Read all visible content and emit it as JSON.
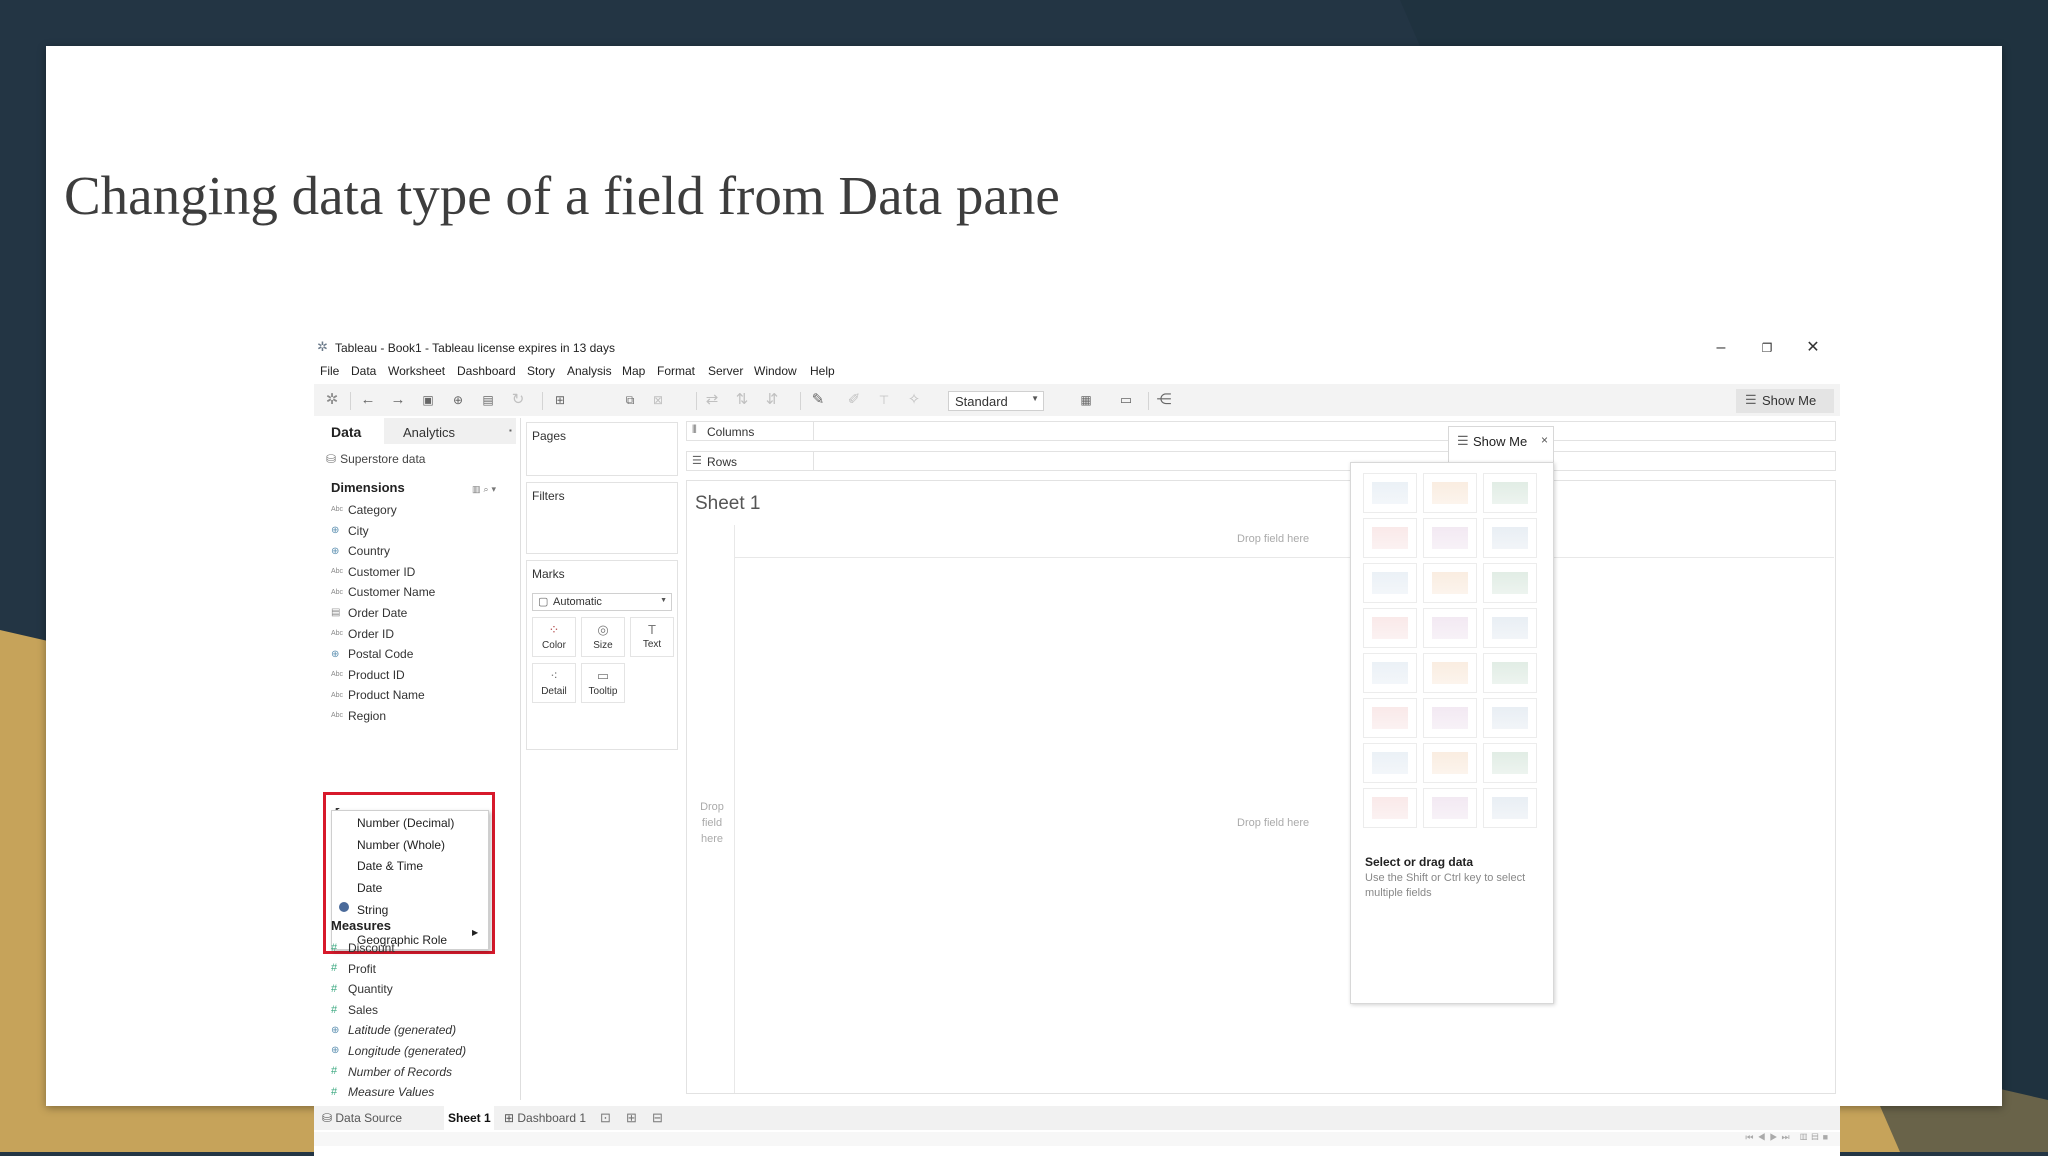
{
  "slide": {
    "title": "Changing data type of a field from Data pane"
  },
  "window": {
    "title": "Tableau - Book1 - Tableau license expires in 13 days",
    "controls": {
      "minimize": "–",
      "restore": "❐",
      "close": "✕"
    }
  },
  "menu": [
    "File",
    "Data",
    "Worksheet",
    "Dashboard",
    "Story",
    "Analysis",
    "Map",
    "Format",
    "Server",
    "Window",
    "Help"
  ],
  "toolbar": {
    "fit_select": "Standard",
    "show_me": "Show Me"
  },
  "data_pane": {
    "tab_data": "Data",
    "tab_analytics": "Analytics",
    "datasource": "Superstore data",
    "dimensions_header": "Dimensions",
    "dimensions": [
      {
        "label": "Category",
        "type": "Abc"
      },
      {
        "label": "City",
        "type": "geo"
      },
      {
        "label": "Country",
        "type": "geo"
      },
      {
        "label": "Customer ID",
        "type": "Abc"
      },
      {
        "label": "Customer Name",
        "type": "Abc"
      },
      {
        "label": "Order Date",
        "type": "date"
      },
      {
        "label": "Order ID",
        "type": "Abc"
      },
      {
        "label": "Postal Code",
        "type": "geo"
      },
      {
        "label": "Product ID",
        "type": "Abc"
      },
      {
        "label": "Product Name",
        "type": "Abc"
      },
      {
        "label": "Region",
        "type": "Abc"
      }
    ],
    "measures_header": "Measures",
    "measures": [
      {
        "label": "Discount",
        "type": "num",
        "italic": false
      },
      {
        "label": "Profit",
        "type": "num",
        "italic": false
      },
      {
        "label": "Quantity",
        "type": "num",
        "italic": false
      },
      {
        "label": "Sales",
        "type": "num",
        "italic": false
      },
      {
        "label": "Latitude (generated)",
        "type": "geo",
        "italic": true
      },
      {
        "label": "Longitude (generated)",
        "type": "geo",
        "italic": true
      },
      {
        "label": "Number of Records",
        "type": "num",
        "italic": true
      },
      {
        "label": "Measure Values",
        "type": "num",
        "italic": true
      }
    ]
  },
  "context_menu": {
    "items": [
      "Number (Decimal)",
      "Number (Whole)",
      "Date & Time",
      "Date",
      "String",
      "Geographic Role"
    ],
    "selected": "String"
  },
  "shelves": {
    "pages": "Pages",
    "filters": "Filters",
    "marks": "Marks",
    "marks_type": "Automatic",
    "mark_buttons": [
      "Color",
      "Size",
      "Text",
      "Detail",
      "Tooltip"
    ],
    "columns": "Columns",
    "rows": "Rows"
  },
  "view": {
    "sheet_title": "Sheet 1",
    "drop_field": "Drop field here",
    "drop_field_left": "Drop field here"
  },
  "show_me": {
    "title": "Show Me",
    "close": "×",
    "hint_title": "Select or drag data",
    "hint_text": "Use the Shift or Ctrl key to select multiple fields",
    "tiles": [
      "text-table",
      "heat-map",
      "highlight-table",
      "symbol-map",
      "filled-map",
      "pie-chart",
      "horizontal-bars",
      "stacked-bars",
      "side-by-side-bars",
      "treemap",
      "circle-views",
      "side-by-side-circles",
      "continuous-lines",
      "discrete-lines",
      "dual-lines",
      "area-continuous",
      "area-discrete",
      "dual-combination",
      "scatter-plot",
      "histogram",
      "box-and-whisker",
      "gantt-chart",
      "bullet-graph",
      "packed-bubbles"
    ]
  },
  "statusbar": {
    "data_source": "Data Source",
    "sheet1": "Sheet 1",
    "dashboard1": "Dashboard 1"
  }
}
